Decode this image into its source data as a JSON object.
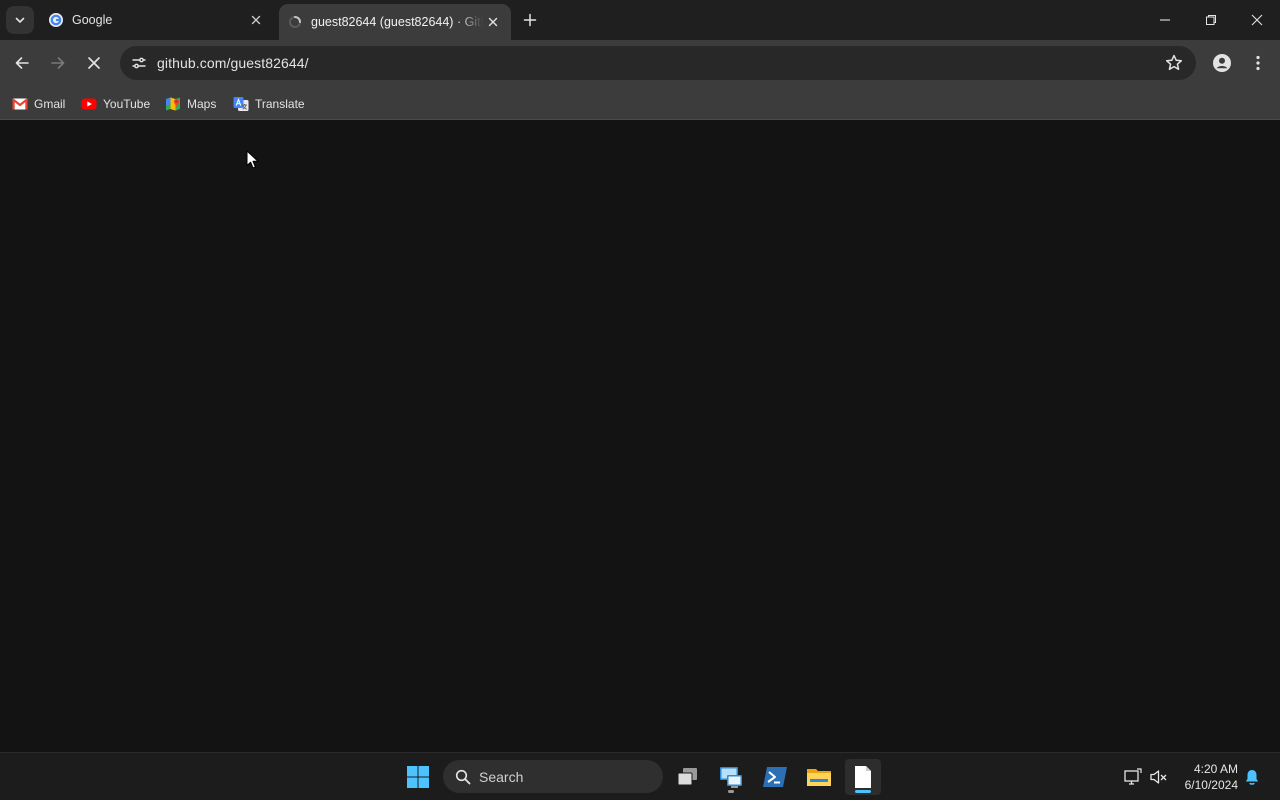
{
  "browser": {
    "tabs": [
      {
        "title": "Google",
        "favicon": "google-g-icon",
        "active": false
      },
      {
        "title": "guest82644 (guest82644) · GitHub",
        "favicon": "loading-spinner-icon",
        "active": true
      }
    ],
    "address_bar": {
      "url": "github.com/guest82644/"
    },
    "bookmarks": [
      {
        "label": "Gmail",
        "icon": "gmail-icon"
      },
      {
        "label": "YouTube",
        "icon": "youtube-icon"
      },
      {
        "label": "Maps",
        "icon": "maps-icon"
      },
      {
        "label": "Translate",
        "icon": "translate-icon"
      }
    ],
    "page_state": "loading"
  },
  "taskbar": {
    "search_label": "Search",
    "pinned": [
      "start-icon",
      "search-icon",
      "task-view-icon",
      "remote-desktop-icon",
      "powershell-icon",
      "file-explorer-icon",
      "notepad-icon"
    ],
    "clock": {
      "time": "4:20 AM",
      "date": "6/10/2024"
    }
  },
  "colors": {
    "tabstrip_bg": "#1f1f1f",
    "toolbar_bg": "#3c3c3c",
    "page_bg": "#131313",
    "taskbar_bg": "#1c1c1c",
    "accent": "#4cc2ff"
  }
}
